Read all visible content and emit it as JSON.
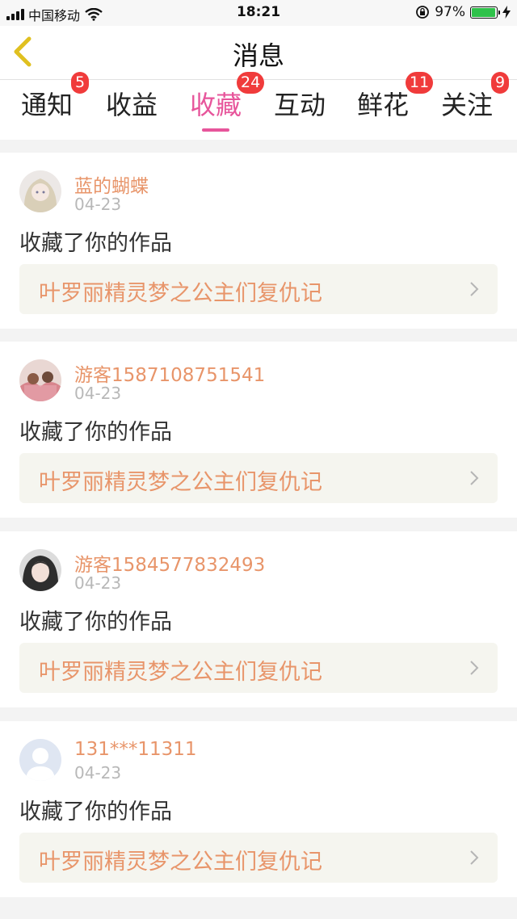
{
  "status": {
    "carrier": "中国移动",
    "time": "18:21",
    "battery": "97%",
    "battery_level": 0.97,
    "icons": [
      "signal-icon",
      "wifi-icon",
      "rotation-lock-icon",
      "battery-icon",
      "charging-icon"
    ]
  },
  "nav": {
    "title": "消息",
    "back_icon": "chevron-left-icon",
    "accent_color": "#e7559b",
    "back_color": "#e0c020"
  },
  "tabs": [
    {
      "label": "通知",
      "badge": "5"
    },
    {
      "label": "收益",
      "badge": ""
    },
    {
      "label": "收藏",
      "badge": "24",
      "active": true
    },
    {
      "label": "互动",
      "badge": ""
    },
    {
      "label": "鲜花",
      "badge": "11"
    },
    {
      "label": "关注",
      "badge": "9"
    }
  ],
  "items": [
    {
      "user": "蓝的蝴蝶",
      "date": "04-23",
      "action": "收藏了你的作品",
      "work": "叶罗丽精灵梦之公主们复仇记"
    },
    {
      "user": "游客1587108751541",
      "date": "04-23",
      "action": "收藏了你的作品",
      "work": "叶罗丽精灵梦之公主们复仇记"
    },
    {
      "user": "游客1584577832493",
      "date": "04-23",
      "action": "收藏了你的作品",
      "work": "叶罗丽精灵梦之公主们复仇记"
    },
    {
      "user": "131***11311",
      "date": "04-23",
      "action": "收藏了你的作品",
      "work": "叶罗丽精灵梦之公主们复仇记"
    }
  ]
}
